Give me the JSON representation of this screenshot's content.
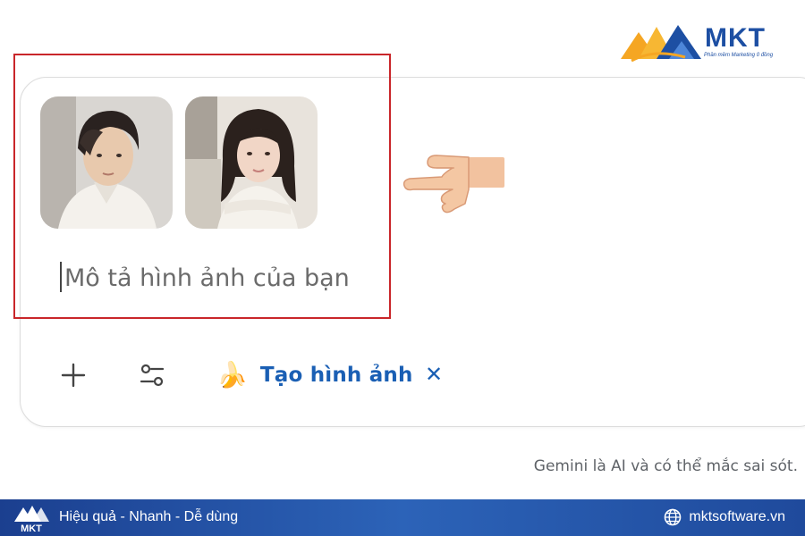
{
  "brand": {
    "logo_text": "MKT",
    "logo_tagline": "Phần mềm Marketing 0 đồng",
    "primary_color": "#1d4fa3",
    "accent_color": "#f5a623"
  },
  "prompt": {
    "placeholder": "Mô tả hình ảnh của bạn",
    "attachments": [
      {
        "icon": "portrait-photo-male"
      },
      {
        "icon": "portrait-photo-female"
      }
    ]
  },
  "toolbar": {
    "add_icon": "plus-icon",
    "tools_icon": "sliders-icon",
    "chip_emoji": "🍌",
    "chip_label": "Tạo hình ảnh",
    "chip_close": "✕",
    "chip_color": "#1a5fb4"
  },
  "disclaimer": "Gemini là AI và có thể mắc sai sót.",
  "annotation": {
    "highlight_color": "#c9262a",
    "pointer_icon": "pointing-hand-icon"
  },
  "footer": {
    "logo_text": "MKT",
    "tagline": "Hiệu quả - Nhanh - Dễ dùng",
    "website": "mktsoftware.vn"
  }
}
